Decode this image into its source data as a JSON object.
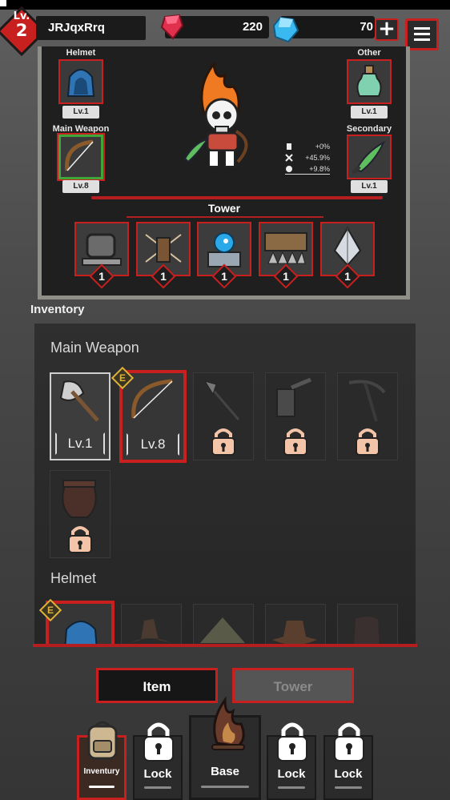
{
  "hud": {
    "level_prefix": "Lv.",
    "level": "2",
    "player_name": "JRJqxRrq",
    "red_gems": "220",
    "blue_gems": "70",
    "plus_label": "+"
  },
  "equipment": {
    "helmet": {
      "label": "Helmet",
      "level": "Lv.1"
    },
    "other": {
      "label": "Other",
      "level": "Lv.1"
    },
    "main_weapon": {
      "label": "Main Weapon",
      "level": "Lv.8"
    },
    "secondary": {
      "label": "Secondary",
      "level": "Lv.1"
    },
    "stats": [
      "+0%",
      "+45.9%",
      "+9.8%"
    ]
  },
  "tower": {
    "title": "Tower",
    "cards": [
      {
        "name": "cauldron",
        "count": "1"
      },
      {
        "name": "crossbow",
        "count": "1"
      },
      {
        "name": "spirit",
        "count": "1"
      },
      {
        "name": "spike-trap",
        "count": "1"
      },
      {
        "name": "crystal",
        "count": "1"
      }
    ]
  },
  "inventory": {
    "title": "Inventory",
    "main_weapon_section": "Main Weapon",
    "helmet_section": "Helmet",
    "items": [
      {
        "name": "axe",
        "level": "Lv.1",
        "locked": false
      },
      {
        "name": "bow",
        "level": "Lv.8",
        "locked": false,
        "equipped_badge": "E"
      },
      {
        "name": "spear",
        "locked": true
      },
      {
        "name": "hammer",
        "locked": true
      },
      {
        "name": "scythe",
        "locked": true
      },
      {
        "name": "pot",
        "locked": true
      }
    ],
    "helmet_badge": "E"
  },
  "tabs": {
    "item": "Item",
    "tower": "Tower"
  },
  "nav": {
    "inventory": "Inventury",
    "lock1": "Lock",
    "base": "Base",
    "lock2": "Lock",
    "lock3": "Lock"
  },
  "colors": {
    "accent": "#c8201f",
    "panel": "#1f1f1f",
    "rarity_green": "#3fa63a",
    "equipped_gold": "#e0b23a"
  }
}
